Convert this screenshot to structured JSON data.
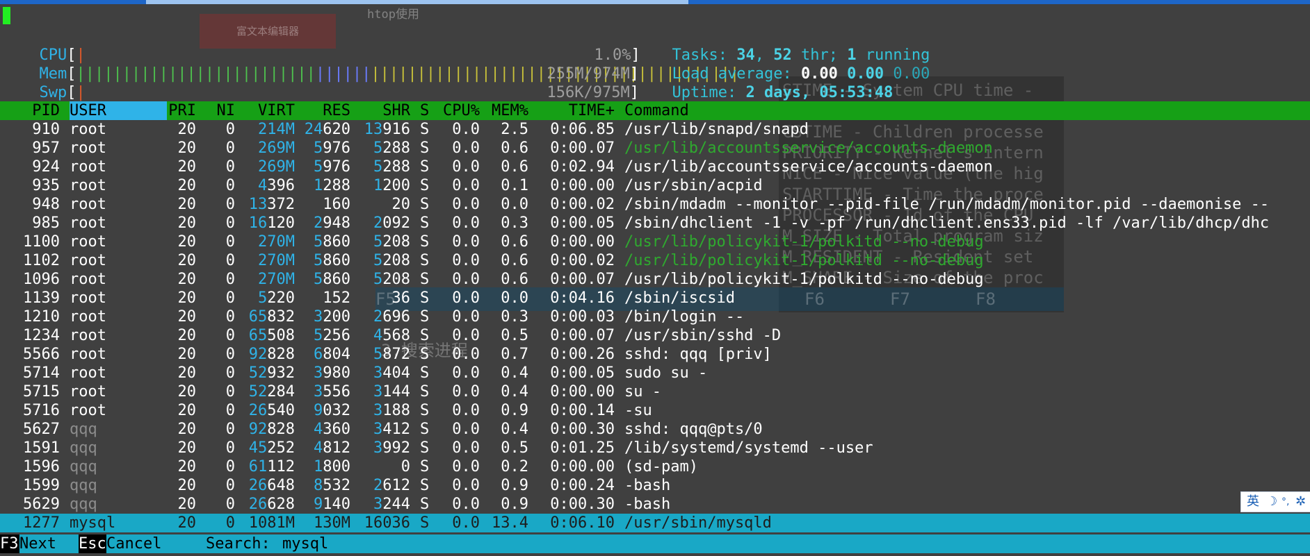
{
  "background_window": {
    "editor_button": "富文本编辑器",
    "title": "htop使用",
    "help_panel_lines": [
      "STIME - System CPU time -",
      "CUTIME - Children processe",
      "CSTIME - Children processe",
      "PRIORITY - Kernel's intern",
      "NICE - Nice value (the hig",
      "STARTTIME - Time the proce",
      "PROCESSOR - Id of the CPU",
      "M_SIZE - Total program siz",
      "M_RESIDENT - Resident set",
      "M_SHARE - Size of the proc"
    ],
    "fkeys": [
      "F5",
      "F6",
      "F7",
      "F8"
    ],
    "heading": "3.搜索进程"
  },
  "meters": {
    "cpu": {
      "label": "CPU",
      "bar": "|",
      "value": "1.0%",
      "percent": 1.0
    },
    "mem": {
      "label": "Mem",
      "bar_green": "||||||||||||||||||||||||||",
      "bar_blue": "||||||",
      "bar_yellow": "||||||||||||||||||||||||||||||||||||||||",
      "value": "255M/974M"
    },
    "swp": {
      "label": "Swp",
      "bar": "|",
      "value": "156K/975M"
    }
  },
  "summary": {
    "tasks_label": "Tasks: ",
    "tasks": "34",
    "sep": ", ",
    "threads": "52",
    "thr_label": " thr; ",
    "running": "1",
    "running_label": " running",
    "load_label": "Load average: ",
    "load1": "0.00",
    "load5": "0.00",
    "load15": "0.00",
    "uptime_label": "Uptime: ",
    "uptime": "2 days, 05:53:48"
  },
  "columns": {
    "pid": "PID",
    "user": "USER",
    "pri": "PRI",
    "ni": "NI",
    "virt": "VIRT",
    "res": "RES",
    "shr": "SHR",
    "s": "S",
    "cpu": "CPU%",
    "mem": "MEM%",
    "time": "TIME+",
    "command": "Command"
  },
  "processes": [
    {
      "pid": "910",
      "user": "root",
      "pri": "20",
      "ni": "0",
      "virt": "214M",
      "res": "24620",
      "shr": "13916",
      "s": "S",
      "cpu": "0.0",
      "mem": "2.5",
      "time": "0:06.85",
      "command": "/usr/lib/snapd/snapd",
      "thread": false
    },
    {
      "pid": "957",
      "user": "root",
      "pri": "20",
      "ni": "0",
      "virt": "269M",
      "res": "5976",
      "shr": "5288",
      "s": "S",
      "cpu": "0.0",
      "mem": "0.6",
      "time": "0:00.07",
      "command": "/usr/lib/accountsservice/accounts-daemon",
      "thread": true
    },
    {
      "pid": "924",
      "user": "root",
      "pri": "20",
      "ni": "0",
      "virt": "269M",
      "res": "5976",
      "shr": "5288",
      "s": "S",
      "cpu": "0.0",
      "mem": "0.6",
      "time": "0:02.94",
      "command": "/usr/lib/accountsservice/accounts-daemon",
      "thread": false
    },
    {
      "pid": "935",
      "user": "root",
      "pri": "20",
      "ni": "0",
      "virt": "4396",
      "res": "1288",
      "shr": "1200",
      "s": "S",
      "cpu": "0.0",
      "mem": "0.1",
      "time": "0:00.00",
      "command": "/usr/sbin/acpid",
      "thread": false
    },
    {
      "pid": "948",
      "user": "root",
      "pri": "20",
      "ni": "0",
      "virt": "13372",
      "res": "160",
      "shr": "20",
      "s": "S",
      "cpu": "0.0",
      "mem": "0.0",
      "time": "0:00.02",
      "command": "/sbin/mdadm --monitor --pid-file /run/mdadm/monitor.pid --daemonise --",
      "thread": false
    },
    {
      "pid": "985",
      "user": "root",
      "pri": "20",
      "ni": "0",
      "virt": "16120",
      "res": "2948",
      "shr": "2092",
      "s": "S",
      "cpu": "0.0",
      "mem": "0.3",
      "time": "0:00.05",
      "command": "/sbin/dhclient -1 -v -pf /run/dhclient.ens33.pid -lf /var/lib/dhcp/dhc",
      "thread": false
    },
    {
      "pid": "1100",
      "user": "root",
      "pri": "20",
      "ni": "0",
      "virt": "270M",
      "res": "5860",
      "shr": "5208",
      "s": "S",
      "cpu": "0.0",
      "mem": "0.6",
      "time": "0:00.00",
      "command": "/usr/lib/policykit-1/polkitd --no-debug",
      "thread": true
    },
    {
      "pid": "1102",
      "user": "root",
      "pri": "20",
      "ni": "0",
      "virt": "270M",
      "res": "5860",
      "shr": "5208",
      "s": "S",
      "cpu": "0.0",
      "mem": "0.6",
      "time": "0:00.02",
      "command": "/usr/lib/policykit-1/polkitd --no-debug",
      "thread": true
    },
    {
      "pid": "1096",
      "user": "root",
      "pri": "20",
      "ni": "0",
      "virt": "270M",
      "res": "5860",
      "shr": "5208",
      "s": "S",
      "cpu": "0.0",
      "mem": "0.6",
      "time": "0:00.07",
      "command": "/usr/lib/policykit-1/polkitd --no-debug",
      "thread": false
    },
    {
      "pid": "1139",
      "user": "root",
      "pri": "20",
      "ni": "0",
      "virt": "5220",
      "res": "152",
      "shr": "36",
      "s": "S",
      "cpu": "0.0",
      "mem": "0.0",
      "time": "0:04.16",
      "command": "/sbin/iscsid",
      "thread": false
    },
    {
      "pid": "1210",
      "user": "root",
      "pri": "20",
      "ni": "0",
      "virt": "65832",
      "res": "3200",
      "shr": "2696",
      "s": "S",
      "cpu": "0.0",
      "mem": "0.3",
      "time": "0:00.03",
      "command": "/bin/login --",
      "thread": false
    },
    {
      "pid": "1234",
      "user": "root",
      "pri": "20",
      "ni": "0",
      "virt": "65508",
      "res": "5256",
      "shr": "4568",
      "s": "S",
      "cpu": "0.0",
      "mem": "0.5",
      "time": "0:00.07",
      "command": "/usr/sbin/sshd -D",
      "thread": false
    },
    {
      "pid": "5566",
      "user": "root",
      "pri": "20",
      "ni": "0",
      "virt": "92828",
      "res": "6804",
      "shr": "5872",
      "s": "S",
      "cpu": "0.0",
      "mem": "0.7",
      "time": "0:00.26",
      "command": "sshd: qqq [priv]",
      "thread": false
    },
    {
      "pid": "5714",
      "user": "root",
      "pri": "20",
      "ni": "0",
      "virt": "52932",
      "res": "3980",
      "shr": "3404",
      "s": "S",
      "cpu": "0.0",
      "mem": "0.4",
      "time": "0:00.05",
      "command": "sudo su -",
      "thread": false
    },
    {
      "pid": "5715",
      "user": "root",
      "pri": "20",
      "ni": "0",
      "virt": "52284",
      "res": "3556",
      "shr": "3144",
      "s": "S",
      "cpu": "0.0",
      "mem": "0.4",
      "time": "0:00.00",
      "command": "su -",
      "thread": false
    },
    {
      "pid": "5716",
      "user": "root",
      "pri": "20",
      "ni": "0",
      "virt": "26540",
      "res": "9032",
      "shr": "3188",
      "s": "S",
      "cpu": "0.0",
      "mem": "0.9",
      "time": "0:00.14",
      "command": "-su",
      "thread": false
    },
    {
      "pid": "5627",
      "user": "qqq",
      "pri": "20",
      "ni": "0",
      "virt": "92828",
      "res": "4360",
      "shr": "3412",
      "s": "S",
      "cpu": "0.0",
      "mem": "0.4",
      "time": "0:00.30",
      "command": "sshd: qqq@pts/0",
      "thread": false
    },
    {
      "pid": "1591",
      "user": "qqq",
      "pri": "20",
      "ni": "0",
      "virt": "45252",
      "res": "4812",
      "shr": "3992",
      "s": "S",
      "cpu": "0.0",
      "mem": "0.5",
      "time": "0:01.25",
      "command": "/lib/systemd/systemd --user",
      "thread": false
    },
    {
      "pid": "1596",
      "user": "qqq",
      "pri": "20",
      "ni": "0",
      "virt": "61112",
      "res": "1800",
      "shr": "0",
      "s": "S",
      "cpu": "0.0",
      "mem": "0.2",
      "time": "0:00.00",
      "command": "(sd-pam)",
      "thread": false
    },
    {
      "pid": "1599",
      "user": "qqq",
      "pri": "20",
      "ni": "0",
      "virt": "26648",
      "res": "8532",
      "shr": "2612",
      "s": "S",
      "cpu": "0.0",
      "mem": "0.9",
      "time": "0:00.24",
      "command": "-bash",
      "thread": false
    },
    {
      "pid": "5629",
      "user": "qqq",
      "pri": "20",
      "ni": "0",
      "virt": "26628",
      "res": "9140",
      "shr": "3244",
      "s": "S",
      "cpu": "0.0",
      "mem": "0.9",
      "time": "0:00.30",
      "command": "-bash",
      "thread": false
    },
    {
      "pid": "1277",
      "user": "mysql",
      "pri": "20",
      "ni": "0",
      "virt": "1081M",
      "res": "130M",
      "shr": "16036",
      "s": "S",
      "cpu": "0.0",
      "mem": "13.4",
      "time": "0:06.10",
      "command": "/usr/sbin/mysqld",
      "thread": false,
      "selected": true
    }
  ],
  "footer": {
    "f3_key": "F3",
    "f3_label": "Next",
    "esc_key": "Esc",
    "esc_label": "Cancel",
    "search_label": "Search: ",
    "search_value": "mysql"
  },
  "ime": {
    "mode": "英",
    "moon": "☽",
    "punct": "°,",
    "gear": "✲"
  },
  "colors": {
    "terminal_bg": "#404040",
    "header_green": "#16a016",
    "selected_cyan": "#19a8c6",
    "meter_label": "#2fb3e8",
    "thread_green": "#2faa2f",
    "cursor_green": "#22ee22"
  }
}
